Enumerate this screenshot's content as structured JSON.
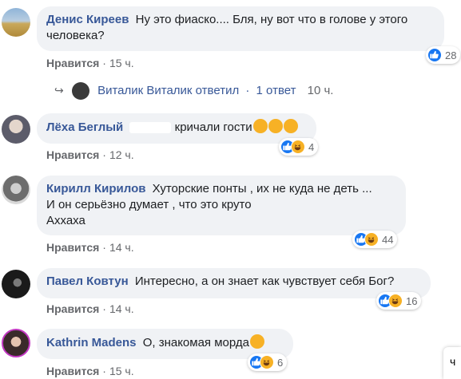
{
  "comments": [
    {
      "author": "Денис Киреев",
      "text": "Ну это фиаско.... Бля, ну вот что в голове у этого",
      "text2": "человека?",
      "like_label": "Нравится",
      "time": "15 ч.",
      "reaction_count": "28"
    },
    {
      "author": "Лёха Беглый",
      "text": "кричали гости",
      "like_label": "Нравится",
      "time": "12 ч.",
      "reaction_count": "4"
    },
    {
      "author": "Кирилл Кирилов",
      "text": "Хуторские понты , их не куда не деть ...",
      "text2": "И он серьёзно думает , что это круто",
      "text3": "Аххаха",
      "like_label": "Нравится",
      "time": "14 ч.",
      "reaction_count": "44"
    },
    {
      "author": "Павел Ковтун",
      "text": "Интересно, а он знает как чувствует себя Бог?",
      "like_label": "Нравится",
      "time": "14 ч.",
      "reaction_count": "16"
    },
    {
      "author": "Kathrin Madens",
      "text": "О, знакомая морда",
      "like_label": "Нравится",
      "time": "15 ч.",
      "reaction_count": "6"
    }
  ],
  "reply": {
    "author": "Виталик Виталик",
    "verb": "ответил",
    "count": "1 ответ",
    "time": "10 ч."
  },
  "colors": {
    "author": "#385898",
    "bubble": "#f0f2f5",
    "meta": "#65676b",
    "like": "#1877f2",
    "haha": "#f7b125"
  }
}
